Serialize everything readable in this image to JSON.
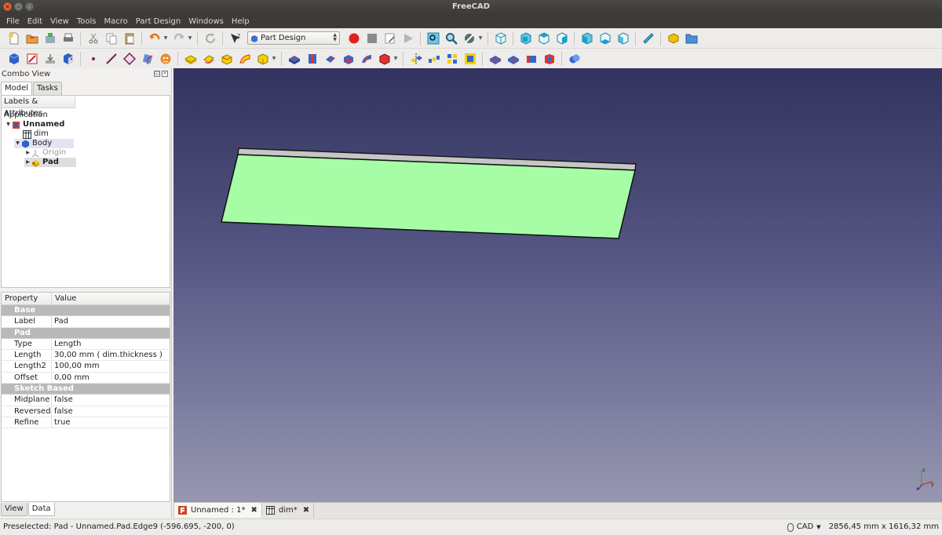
{
  "window": {
    "title": "FreeCAD"
  },
  "menubar": [
    "File",
    "Edit",
    "View",
    "Tools",
    "Macro",
    "Part Design",
    "Windows",
    "Help"
  ],
  "workbench": {
    "selected": "Part Design"
  },
  "combo_view": {
    "title": "Combo View",
    "tabs": [
      "Model",
      "Tasks"
    ],
    "active_tab": "Model",
    "tree_header": "Labels & Attributes",
    "tree": {
      "root": "Application",
      "document": "Unnamed",
      "items": [
        {
          "label": "dim",
          "icon": "spreadsheet-icon"
        },
        {
          "label": "Body",
          "icon": "body-icon"
        },
        {
          "label": "Origin",
          "icon": "origin-icon"
        },
        {
          "label": "Pad",
          "icon": "pad-icon"
        }
      ]
    }
  },
  "properties": {
    "headers": {
      "property": "Property",
      "value": "Value"
    },
    "groups": [
      {
        "name": "Base",
        "rows": [
          {
            "name": "Label",
            "value": "Pad"
          }
        ]
      },
      {
        "name": "Pad",
        "rows": [
          {
            "name": "Type",
            "value": "Length"
          },
          {
            "name": "Length",
            "value": "30,00 mm  ( dim.thickness )"
          },
          {
            "name": "Length2",
            "value": "100,00 mm"
          },
          {
            "name": "Offset",
            "value": "0,00 mm"
          }
        ]
      },
      {
        "name": "Sketch Based",
        "rows": [
          {
            "name": "Midplane",
            "value": "false"
          },
          {
            "name": "Reversed",
            "value": "false"
          },
          {
            "name": "Refine",
            "value": "true"
          }
        ]
      }
    ],
    "bottom_tabs": [
      "View",
      "Data"
    ],
    "active_bottom_tab": "Data"
  },
  "document_tabs": [
    {
      "label": "Unnamed : 1*",
      "icon": "freecad-doc-icon",
      "active": true
    },
    {
      "label": "dim*",
      "icon": "spreadsheet-icon",
      "active": false
    }
  ],
  "statusbar": {
    "message": "Preselected: Pad - Unnamed.Pad.Edge9 (-596.695, -200, 0)",
    "navigation_style": "CAD",
    "dimensions": "2856,45 mm x 1616,32 mm"
  },
  "colors": {
    "pad_face": "#a6fda6",
    "viewport_top": "#33335f",
    "viewport_bottom": "#9797b0",
    "record_button": "#e02020"
  }
}
